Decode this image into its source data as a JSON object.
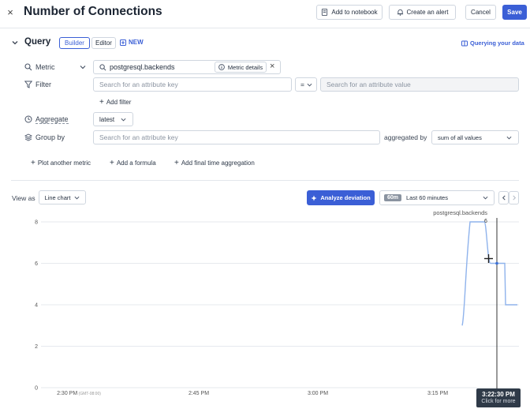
{
  "header": {
    "title": "Number of Connections",
    "add_to_notebook": "Add to notebook",
    "create_alert": "Create an alert",
    "cancel": "Cancel",
    "save": "Save"
  },
  "query": {
    "title": "Query",
    "builder_tab": "Builder",
    "editor_tab": "Editor",
    "new_badge": "NEW",
    "querying_help": "Querying your data",
    "metric_label": "Metric",
    "metric_value": "postgresql.backends",
    "metric_details": "Metric details",
    "filter_label": "Filter",
    "filter_key_placeholder": "Search for an attribute key",
    "filter_operator": "=",
    "filter_value_placeholder": "Search for an attribute value",
    "add_filter": "Add filter",
    "aggregate_label": "Aggregate",
    "aggregate_value": "latest",
    "group_by_label": "Group by",
    "group_by_placeholder": "Search for an attribute key",
    "aggregated_by_label": "aggregated by",
    "aggregated_by_value": "sum of all values",
    "plot_another_metric": "Plot another metric",
    "add_formula": "Add a formula",
    "add_final_time_aggregation": "Add final time aggregation"
  },
  "view": {
    "view_as_label": "View as",
    "chart_type": "Line chart",
    "analyze_deviation": "Analyze deviation",
    "time_badge": "60m",
    "time_range": "Last 60 minutes"
  },
  "tooltip": {
    "time": "3:22:30 PM",
    "hint": "Click for more"
  },
  "chart_data": {
    "type": "line",
    "series": [
      {
        "name": "postgresql.backends",
        "x": [
          "3:17 PM",
          "3:18 PM",
          "3:19 PM",
          "3:20 PM",
          "3:21 PM",
          "3:22 PM",
          "3:23 PM",
          "3:24 PM"
        ],
        "values": [
          3,
          8,
          8,
          8,
          6,
          6,
          6,
          4
        ]
      }
    ],
    "x_tick_labels": [
      "2:30 PM",
      "2:45 PM",
      "3:00 PM",
      "3:15 PM"
    ],
    "x_tick_timezone": "(GMT-08:00)",
    "y_ticks": [
      0,
      2,
      4,
      6,
      8
    ],
    "ylim": [
      0,
      8
    ],
    "hover_value": "6",
    "grid": true,
    "legend": "top-right",
    "colors": {
      "line": "#8fb3ec",
      "marker": "#3b6fd6"
    }
  },
  "colors": {
    "primary": "#3b5fd6",
    "border": "#cfd6df",
    "text": "#1f2a3a"
  }
}
